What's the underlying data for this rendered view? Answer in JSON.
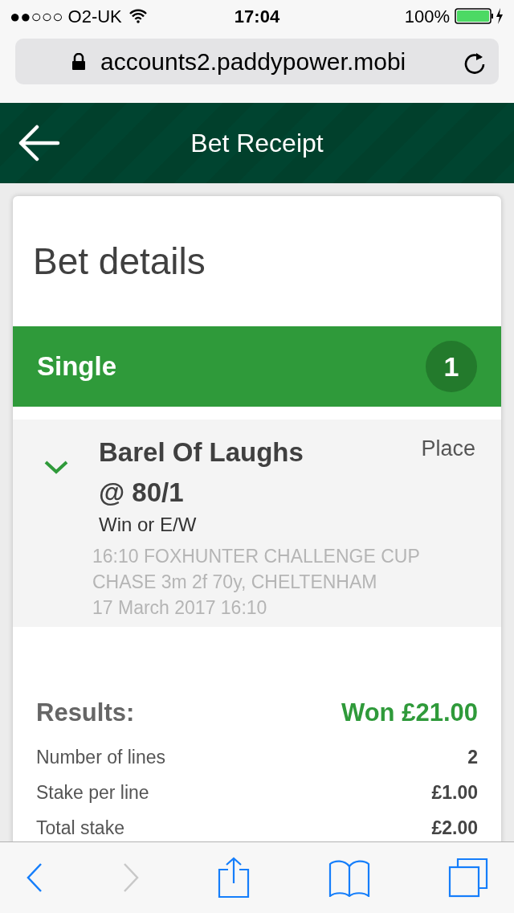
{
  "status_bar": {
    "carrier": "●●○○○ O2-UK",
    "time": "17:04",
    "battery": "100%"
  },
  "address_bar": {
    "url": "accounts2.paddypower.mobi"
  },
  "header": {
    "title": "Bet Receipt"
  },
  "card": {
    "title": "Bet details",
    "bet_type": {
      "label": "Single",
      "count": "1"
    },
    "selection": {
      "expanded": true,
      "name": "Barel Of Laughs @ 80/1",
      "market": "Win or E/W",
      "bet_kind": "Place",
      "event": "16:10 FOXHUNTER CHALLENGE CUP CHASE 3m 2f 70y, CHELTENHAM",
      "date": "17 March 2017 16:10"
    },
    "results": {
      "label": "Results:",
      "outcome": "Won £21.00",
      "rows": [
        {
          "label": "Number of lines",
          "value": "2"
        },
        {
          "label": "Stake per line",
          "value": "£1.00"
        },
        {
          "label": "Total stake",
          "value": "£2.00"
        }
      ]
    }
  },
  "toolbar": {
    "back_disabled": false,
    "forward_disabled": true
  }
}
